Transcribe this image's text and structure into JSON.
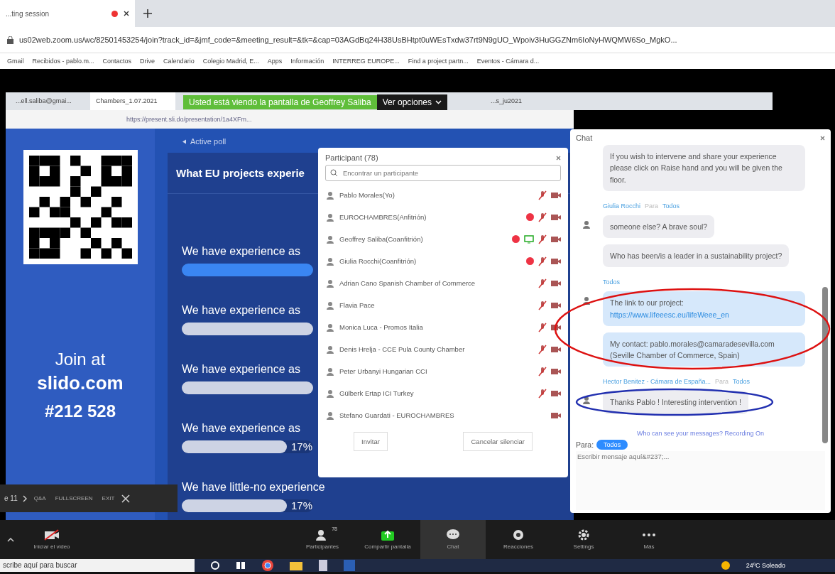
{
  "browser": {
    "tab": {
      "title": "...ting session"
    },
    "url": "us02web.zoom.us/wc/82501453254/join?track_id=&jmf_code=&meeting_result=&tk=&cap=03AGdBq24H38UsBHtpt0uWEsTxdw37rt9N9gUO_Wpoiv3HuGGZNm6IoNyHWQMW6So_MgkO...",
    "bookmarks": [
      "Gmail",
      "Recibidos - pablo.m...",
      "Contactos",
      "Drive",
      "Calendario",
      "Colegio Madrid, E...",
      "Apps",
      "Información",
      "INTERREG EUROPE...",
      "Find a project partn...",
      "Eventos - Cámara d..."
    ]
  },
  "share_banner": {
    "text": "Usted está viendo la pantalla de Geoffrey Saliba",
    "button": "Ver opciones"
  },
  "shared_browser": {
    "tabs": [
      {
        "title": "...ell.saliba@gmai...",
        "selected": false
      },
      {
        "title": "Chambers_1.07.2021",
        "selected": true
      },
      {
        "title": "...s_ju2021",
        "selected": false
      }
    ],
    "url": "https://present.sli.do/presentation/1a4XFm..."
  },
  "slide": {
    "join": "Join at",
    "site": "slido.com",
    "code": "#212 528",
    "poll_label": "Active poll",
    "question": "What EU projects experie",
    "options": [
      {
        "label": "We have experience as",
        "level": 1,
        "selected": true
      },
      {
        "label": "We have experience as",
        "level": 1,
        "selected": false
      },
      {
        "label": "We have experience as",
        "level": 1,
        "selected": false
      },
      {
        "label": "We have experience as",
        "level": 0.8,
        "selected": false,
        "percent": "17%"
      },
      {
        "label": "We have little-no experience",
        "level": 0.8,
        "selected": false,
        "percent": "17%"
      }
    ]
  },
  "slido_bar": {
    "page": "e 11",
    "items": [
      "Q&A",
      "FULLSCREEN",
      "EXIT"
    ]
  },
  "participants": {
    "title": "Participant (78)",
    "search_placeholder": "Encontrar un participante",
    "rows": [
      {
        "name": "Pablo Morales(Yo)",
        "dot": false,
        "sharing": false,
        "muted": true
      },
      {
        "name": "EUROCHAMBRES(Anfitrión)",
        "dot": true,
        "sharing": false,
        "muted": true
      },
      {
        "name": "Geoffrey Saliba(Coanfitrión)",
        "dot": true,
        "sharing": true,
        "muted": true
      },
      {
        "name": "Giulia Rocchi(Coanfitrión)",
        "dot": true,
        "sharing": false,
        "muted": true
      },
      {
        "name": "Adrian Cano Spanish Chamber of Commerce",
        "dot": false,
        "sharing": false,
        "muted": true
      },
      {
        "name": "Flavia Pace",
        "dot": false,
        "sharing": false,
        "muted": true
      },
      {
        "name": "Monica Luca - Promos Italia",
        "dot": false,
        "sharing": false,
        "muted": true
      },
      {
        "name": "Denis Hrelja - CCE Pula County Chamber",
        "dot": false,
        "sharing": false,
        "muted": true
      },
      {
        "name": "Peter Urbanyi Hungarian CCI",
        "dot": false,
        "sharing": false,
        "muted": true
      },
      {
        "name": "Gülberk Ertap ICI Turkey",
        "dot": false,
        "sharing": false,
        "muted": true
      },
      {
        "name": "Stefano Guardati - EUROCHAMBRES",
        "dot": false,
        "sharing": false,
        "muted": false
      }
    ],
    "buttons": [
      "Invitar",
      "Cancelar silenciar"
    ]
  },
  "chat": {
    "title": "Chat",
    "groups": [
      {
        "messages": [
          {
            "text": "If you wish to intervene and share your experience please click on Raise hand and you will be given the floor.",
            "mine": false
          }
        ]
      },
      {
        "sender": "Giulia Rocchi",
        "to_label": "Para",
        "to": "Todos",
        "messages": [
          {
            "text": "someone else? A brave soul?",
            "mine": false
          },
          {
            "text": "Who has been/is a leader in a sustainability project?",
            "mine": false
          }
        ]
      },
      {
        "to": "Todos",
        "messages": [
          {
            "text": "The link to our project:",
            "link": "https://www.lifeeesc.eu/lifeWeee_en",
            "mine": true
          },
          {
            "text": "My contact: pablo.morales@camaradesevilla.com (Seville Chamber of Commerce, Spain)",
            "mine": true
          }
        ]
      },
      {
        "sender": "Hector Benitez - Cámara de España...",
        "to_label": "Para",
        "to": "Todos",
        "messages": [
          {
            "text": "Thanks Pablo ! Interesting intervention !",
            "mine": false
          }
        ]
      }
    ],
    "notice": "Who can see your messages? Recording On",
    "to_label": "Para:",
    "to": "Todos",
    "placeholder": "Escribir mensaje aquí&#237;..."
  },
  "toolbar": {
    "items": [
      {
        "kind": "video",
        "label": "Iniciar el video",
        "selected": false
      },
      {
        "kind": "participants",
        "label": "Participantes",
        "badge": "78",
        "selected": false
      },
      {
        "kind": "share",
        "label": "Compartir pantalla",
        "selected": false
      },
      {
        "kind": "chat",
        "label": "Chat",
        "selected": true
      },
      {
        "kind": "reactions",
        "label": "Reacciones",
        "selected": false
      },
      {
        "kind": "settings",
        "label": "Settings",
        "selected": false
      },
      {
        "kind": "more",
        "label": "Más",
        "selected": false
      }
    ]
  },
  "taskbar": {
    "search": "scribe aquí para buscar",
    "weather": "24ºC Soleado"
  }
}
